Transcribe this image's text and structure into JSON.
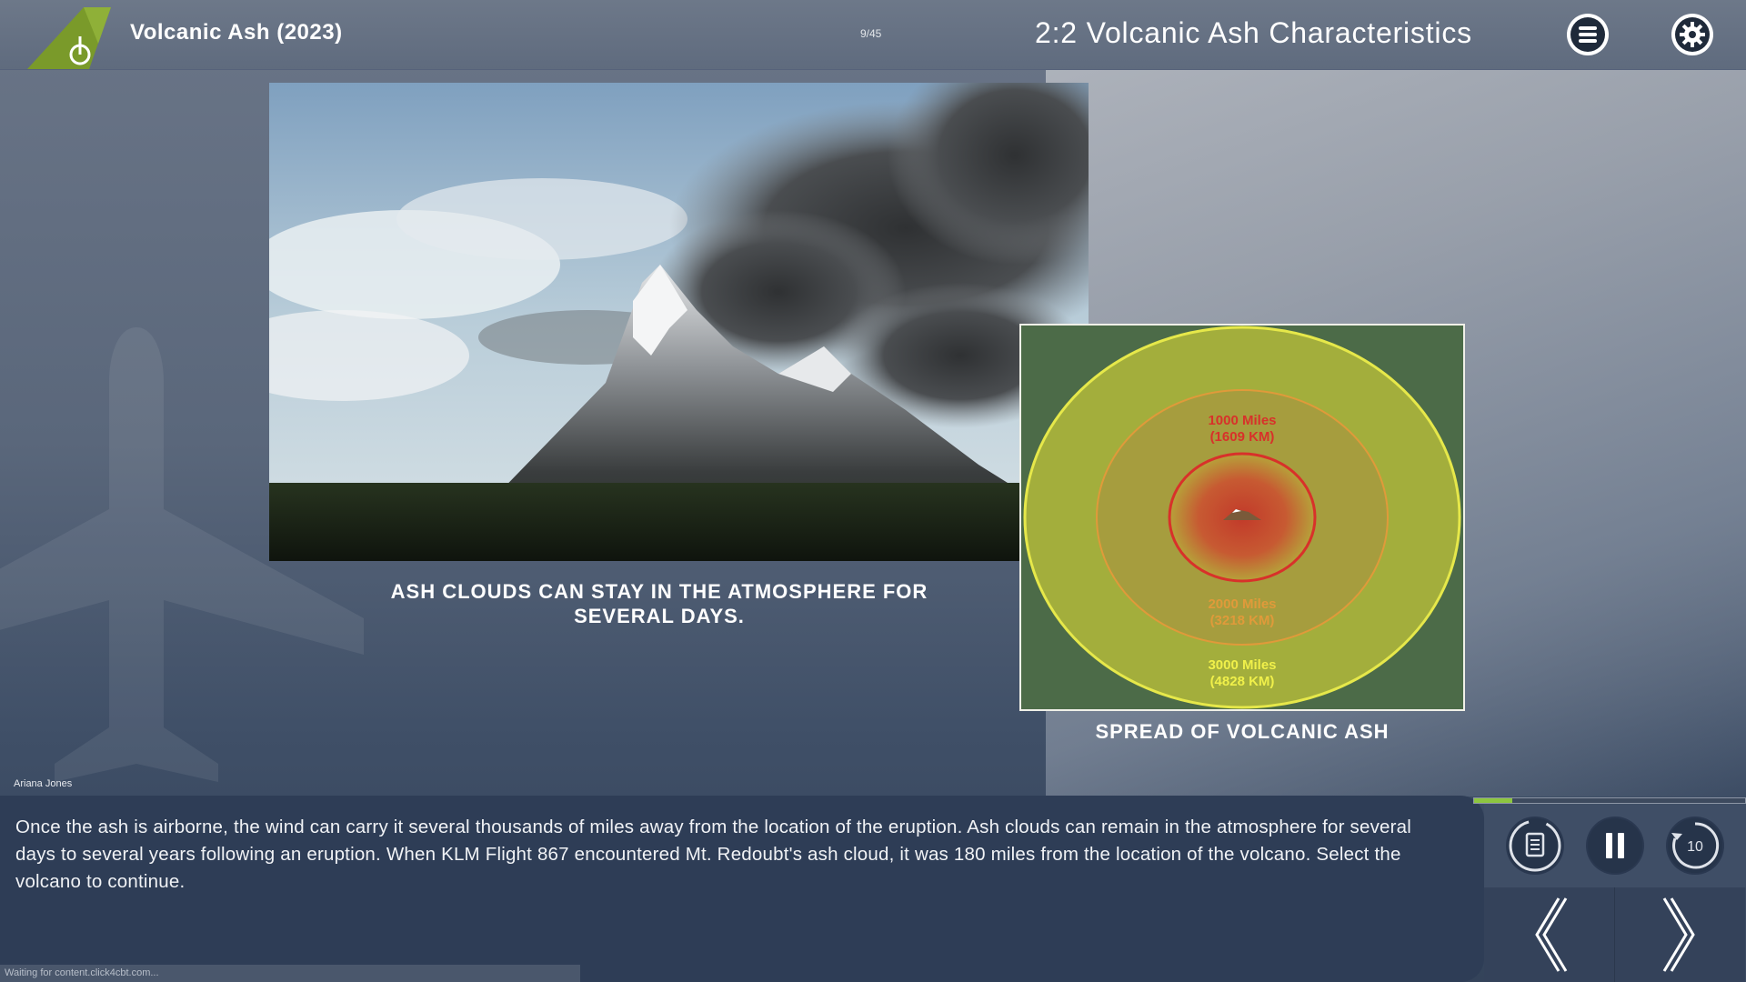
{
  "header": {
    "course_title": "Volcanic Ash (2023)",
    "page_count": "9/45",
    "section_title": "2:2 Volcanic Ash Characteristics"
  },
  "icons": {
    "logo": "airplane-tail-power-logo",
    "menu": "hamburger-menu-icon",
    "settings": "gear-icon",
    "transcript_replay": "transcript-replay-icon",
    "pause": "pause-icon",
    "rewind": "rewind-10-icon",
    "prev": "chevron-left-icon",
    "next": "chevron-right-icon"
  },
  "main": {
    "volcano_caption": "ASH CLOUDS CAN STAY IN THE ATMOSPHERE FOR SEVERAL DAYS.",
    "map": {
      "ring1": "1000 Miles\n(1609 KM)",
      "ring2": "2000 Miles\n(3218 KM)",
      "ring3": "3000 Miles\n(4828 KM)"
    },
    "map_caption": "SPREAD OF VOLCANIC ASH"
  },
  "narrator": "Ariana Jones",
  "transcript": "Once the ash is airborne, the wind can carry it several thousands of miles away from the location of the eruption. Ash clouds can remain in the atmosphere for several days to several years following an eruption. When KLM Flight 867 encountered Mt. Redoubt's ash cloud, it was 180 miles from the location of the volcano. Select the volcano to continue.",
  "status": "Waiting for content.click4cbt.com...",
  "progress_percent": 14,
  "colors": {
    "accent_green": "#8dc63f",
    "logo_green": "#7a9a2a",
    "panel": "#2e3d56"
  }
}
